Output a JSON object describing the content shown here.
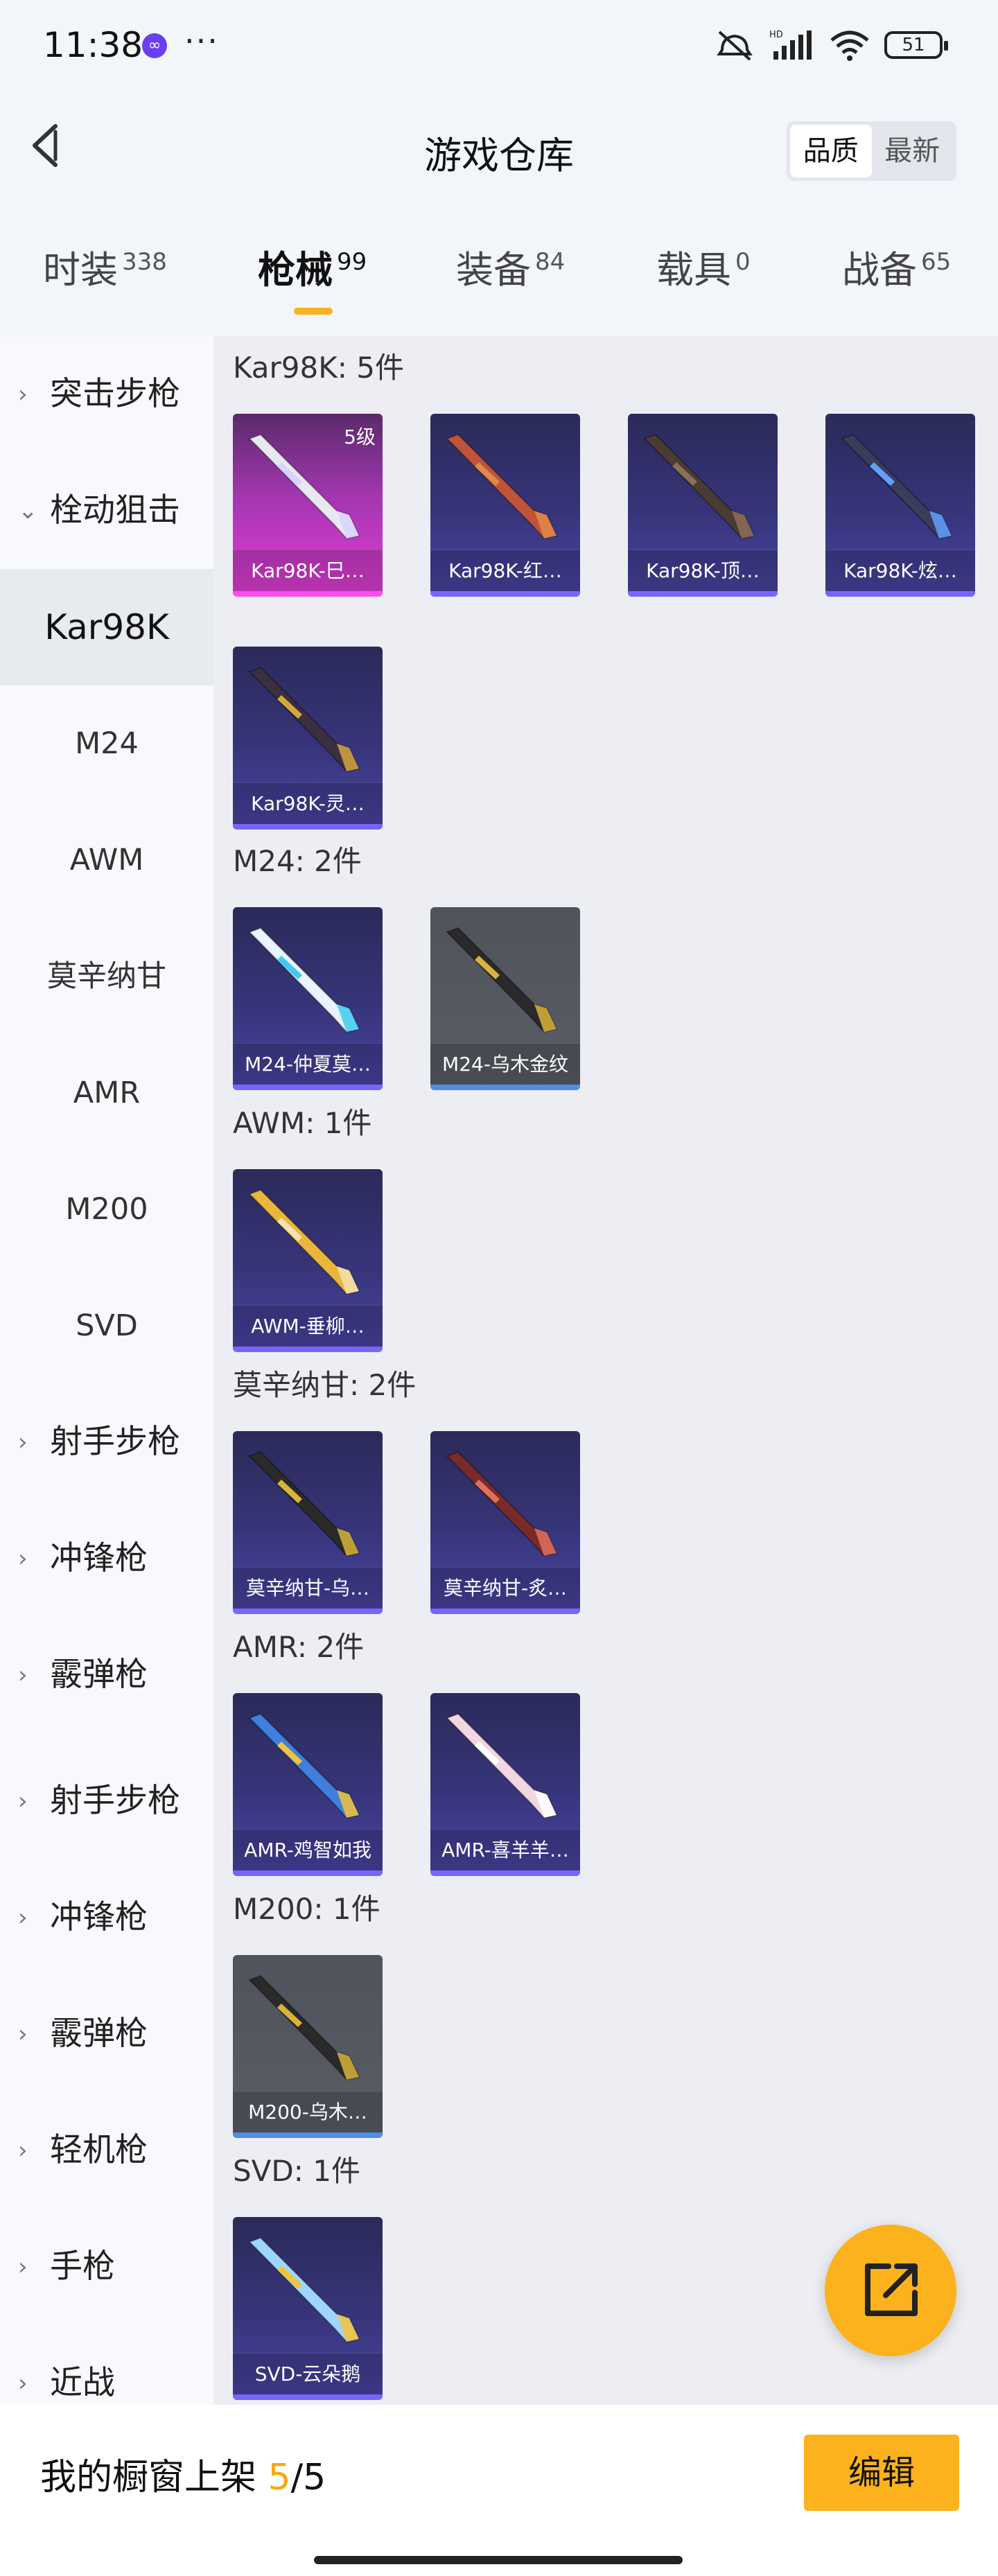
{
  "status_bar": {
    "time": "11:38",
    "app_badge": "∞",
    "more": "···",
    "battery": "51",
    "icons": [
      "mute-icon",
      "signal-icon",
      "wifi-icon",
      "battery-icon"
    ]
  },
  "header": {
    "title": "游戏仓库",
    "sort_options": [
      "品质",
      "最新"
    ],
    "sort_selected": "品质"
  },
  "tabs": [
    {
      "label": "时装",
      "count": "338"
    },
    {
      "label": "枪械",
      "count": "99"
    },
    {
      "label": "装备",
      "count": "84"
    },
    {
      "label": "载具",
      "count": "0"
    },
    {
      "label": "战备",
      "count": "65"
    }
  ],
  "active_tab": "枪械",
  "sidebar": {
    "items": [
      {
        "label": "突击步枪",
        "kind": "category",
        "expanded": false
      },
      {
        "label": "栓动狙击",
        "kind": "category",
        "expanded": true
      },
      {
        "label": "Kar98K",
        "kind": "sub",
        "selected": true
      },
      {
        "label": "M24",
        "kind": "sub"
      },
      {
        "label": "AWM",
        "kind": "sub"
      },
      {
        "label": "莫辛纳甘",
        "kind": "sub"
      },
      {
        "label": "AMR",
        "kind": "sub"
      },
      {
        "label": "M200",
        "kind": "sub"
      },
      {
        "label": "SVD",
        "kind": "sub"
      },
      {
        "label": "射手步枪",
        "kind": "category",
        "expanded": false
      },
      {
        "label": "冲锋枪",
        "kind": "category",
        "expanded": false
      },
      {
        "label": "霰弹枪",
        "kind": "category",
        "expanded": false
      },
      {
        "label": "射手步枪",
        "kind": "category",
        "expanded": false
      },
      {
        "label": "冲锋枪",
        "kind": "category",
        "expanded": false
      },
      {
        "label": "霰弹枪",
        "kind": "category",
        "expanded": false
      },
      {
        "label": "轻机枪",
        "kind": "category",
        "expanded": false
      },
      {
        "label": "手枪",
        "kind": "category",
        "expanded": false
      },
      {
        "label": "近战",
        "kind": "category",
        "expanded": false
      }
    ]
  },
  "groups": [
    {
      "title": "Kar98K: 5件",
      "items": [
        {
          "name": "Kar98K-巳…",
          "level": "5级",
          "style": "pink",
          "gun": "#e8e8f0",
          "accent": "#d9d2ff"
        },
        {
          "name": "Kar98K-红…",
          "style": "purple",
          "gun": "#c0533a",
          "accent": "#e08a4a"
        },
        {
          "name": "Kar98K-顶…",
          "style": "purple",
          "gun": "#4a3b34",
          "accent": "#8c6f58"
        },
        {
          "name": "Kar98K-炫…",
          "style": "purple",
          "gun": "#3a3c5a",
          "accent": "#5fa0ff"
        },
        {
          "name": "Kar98K-灵…",
          "style": "purple",
          "gun": "#3b3040",
          "accent": "#d4a640"
        }
      ]
    },
    {
      "title": "M24: 2件",
      "items": [
        {
          "name": "M24-仲夏莫…",
          "style": "purple",
          "gun": "#e8f4ff",
          "accent": "#3ecbf0"
        },
        {
          "name": "M24-乌木金纹",
          "style": "grey",
          "gun": "#2a2a2a",
          "accent": "#d8b43a"
        }
      ]
    },
    {
      "title": "AWM: 1件",
      "items": [
        {
          "name": "AWM-垂柳…",
          "style": "purple",
          "gun": "#e9b73c",
          "accent": "#f3e2b0"
        }
      ]
    },
    {
      "title": "莫辛纳甘: 2件",
      "items": [
        {
          "name": "莫辛纳甘-乌…",
          "style": "purple",
          "gun": "#2a2a2a",
          "accent": "#d8b43a"
        },
        {
          "name": "莫辛纳甘-炙…",
          "style": "purple",
          "gun": "#7a2a2a",
          "accent": "#e0705a"
        }
      ]
    },
    {
      "title": "AMR: 2件",
      "items": [
        {
          "name": "AMR-鸡智如我",
          "style": "purple",
          "gun": "#3f7fe0",
          "accent": "#f2c33a"
        },
        {
          "name": "AMR-喜羊羊…",
          "style": "purple",
          "gun": "#f3d6e2",
          "accent": "#ffffff"
        }
      ]
    },
    {
      "title": "M200: 1件",
      "items": [
        {
          "name": "M200-乌木…",
          "style": "grey",
          "gun": "#2a2a2a",
          "accent": "#d8b43a"
        }
      ]
    },
    {
      "title": "SVD: 1件",
      "items": [
        {
          "name": "SVD-云朵鹅",
          "style": "purple",
          "gun": "#9fd6ff",
          "accent": "#f2c33a"
        }
      ]
    }
  ],
  "bottom_bar": {
    "label": "我的橱窗上架",
    "current": "5",
    "separator": "/",
    "total": "5",
    "edit_label": "编辑"
  },
  "colors": {
    "accent": "#fbb21c",
    "background": "#f2f5fa"
  }
}
